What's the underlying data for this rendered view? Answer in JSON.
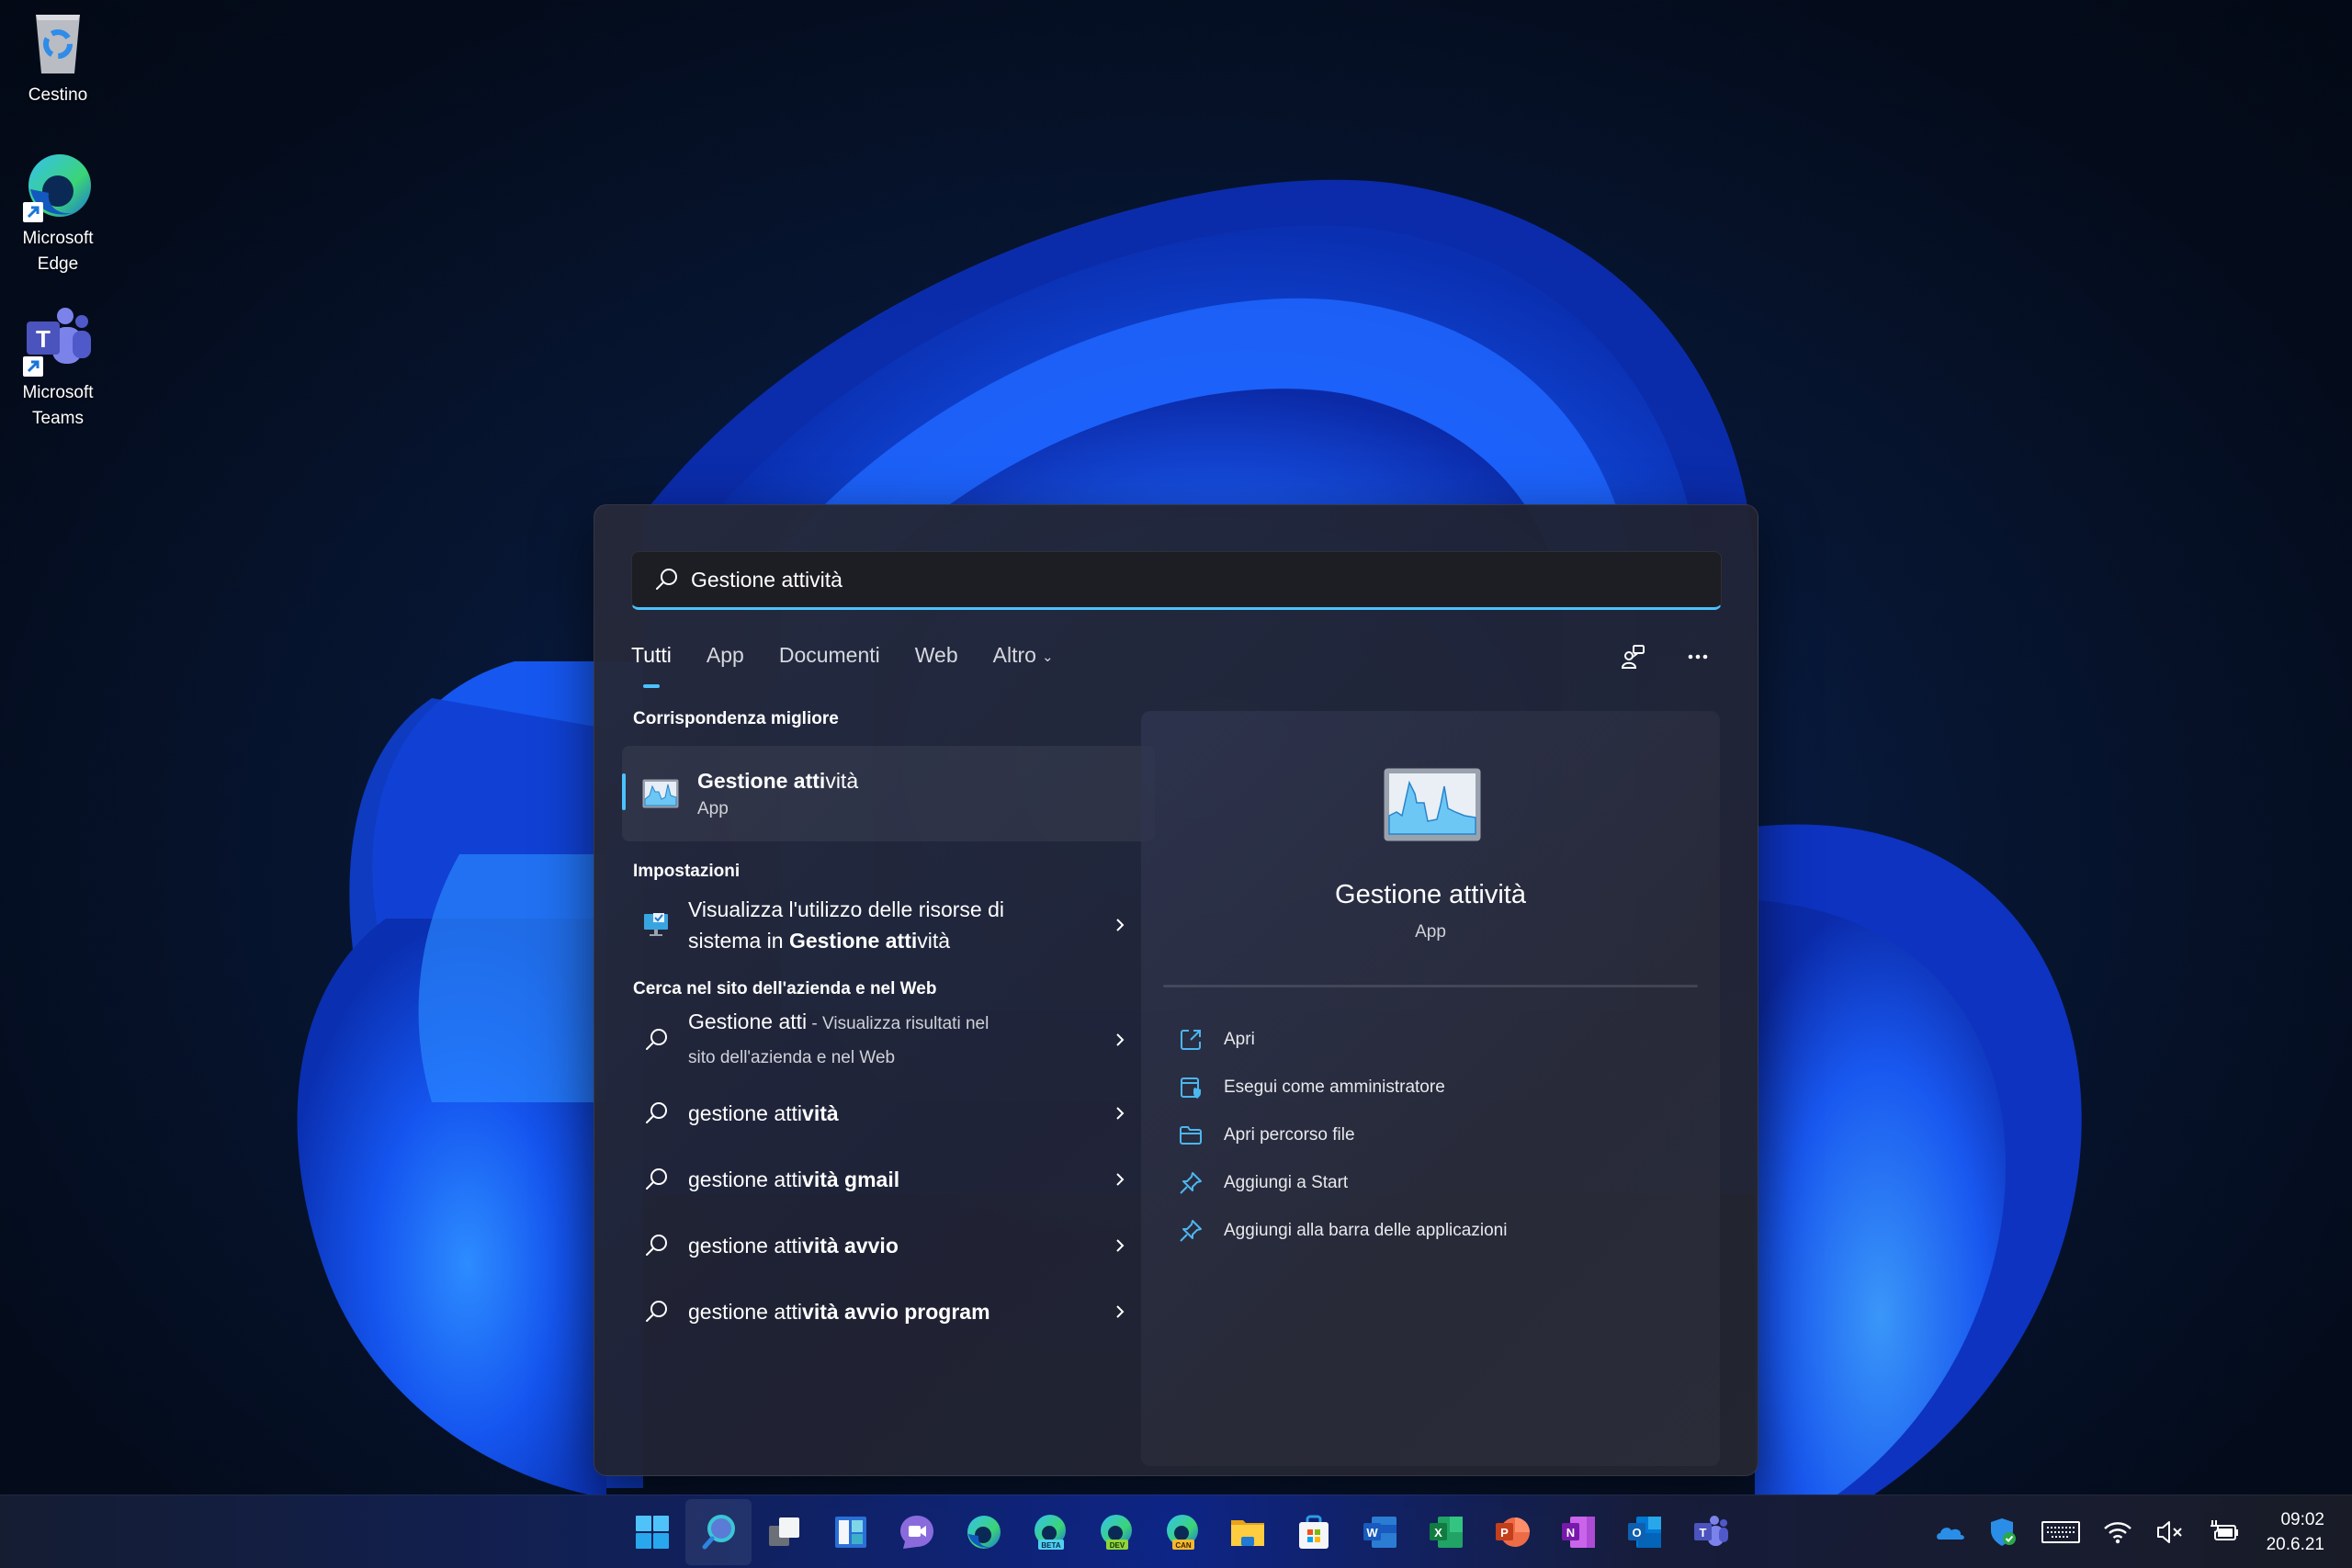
{
  "desktop": {
    "icons": [
      {
        "label": "Cestino",
        "icon": "recycle-bin-icon"
      },
      {
        "label": "Microsoft Edge",
        "icon": "edge-icon"
      },
      {
        "label": "Microsoft Teams",
        "icon": "teams-icon"
      }
    ]
  },
  "search": {
    "query": "Gestione attività",
    "tabs": [
      {
        "label": "Tutti",
        "active": true
      },
      {
        "label": "App"
      },
      {
        "label": "Documenti"
      },
      {
        "label": "Web"
      },
      {
        "label": "Altro"
      }
    ],
    "header_icons": [
      "feedback-icon",
      "more-options-icon"
    ],
    "best_match": {
      "section_title": "Corrispondenza migliore",
      "title_bold": "Gestione atti",
      "title_rest": "vità",
      "subtitle": "App"
    },
    "settings": {
      "section_title": "Impostazioni",
      "item_line1": "Visualizza l'utilizzo delle risorse di",
      "item_line2_prefix": "sistema in ",
      "item_line2_bold": "Gestione atti",
      "item_line2_rest": "vità"
    },
    "web": {
      "section_title": "Cerca nel sito dell'azienda e nel Web",
      "first": {
        "query": "Gestione atti",
        "desc": " - Visualizza risultati nel",
        "desc2": "sito dell'azienda e nel Web"
      },
      "suggestions": [
        {
          "prefix": "gestione atti",
          "bold": "vità"
        },
        {
          "prefix": "gestione atti",
          "bold": "vità gmail"
        },
        {
          "prefix": "gestione atti",
          "bold": "vità avvio"
        },
        {
          "prefix": "gestione atti",
          "bold": "vità avvio program"
        }
      ]
    },
    "preview": {
      "title": "Gestione attività",
      "subtitle": "App",
      "actions": [
        {
          "label": "Apri",
          "icon": "open-external-icon"
        },
        {
          "label": "Esegui come amministratore",
          "icon": "run-as-admin-icon"
        },
        {
          "label": "Apri percorso file",
          "icon": "folder-icon"
        },
        {
          "label": "Aggiungi a Start",
          "icon": "pin-icon"
        },
        {
          "label": "Aggiungi alla barra delle applicazioni",
          "icon": "pin-icon"
        }
      ]
    },
    "accent_color": "#4cc2ff"
  },
  "taskbar": {
    "apps": [
      {
        "name": "Start",
        "icon": "start-icon"
      },
      {
        "name": "Search",
        "icon": "search-icon",
        "active": true
      },
      {
        "name": "Task View",
        "icon": "task-view-icon"
      },
      {
        "name": "Widgets",
        "icon": "widgets-icon"
      },
      {
        "name": "Chat",
        "icon": "chat-icon"
      },
      {
        "name": "Microsoft Edge",
        "icon": "edge-icon"
      },
      {
        "name": "Microsoft Edge Beta",
        "icon": "edge-beta-icon",
        "badge": "BETA"
      },
      {
        "name": "Microsoft Edge Dev",
        "icon": "edge-dev-icon",
        "badge": "DEV"
      },
      {
        "name": "Microsoft Edge Canary",
        "icon": "edge-canary-icon",
        "badge": "CAN"
      },
      {
        "name": "File Explorer",
        "icon": "file-explorer-icon"
      },
      {
        "name": "Microsoft Store",
        "icon": "store-icon"
      },
      {
        "name": "Word",
        "icon": "word-icon",
        "letter": "W"
      },
      {
        "name": "Excel",
        "icon": "excel-icon",
        "letter": "X"
      },
      {
        "name": "PowerPoint",
        "icon": "powerpoint-icon",
        "letter": "P"
      },
      {
        "name": "OneNote",
        "icon": "onenote-icon",
        "letter": "N"
      },
      {
        "name": "Outlook",
        "icon": "outlook-icon",
        "letter": "O"
      },
      {
        "name": "Teams",
        "icon": "teams-icon",
        "letter": "T"
      }
    ],
    "tray": [
      "onedrive-icon",
      "security-icon",
      "keyboard-icon",
      "wifi-icon",
      "volume-muted-icon",
      "battery-charging-icon"
    ],
    "time": "09:02",
    "date": "20.6.21"
  }
}
